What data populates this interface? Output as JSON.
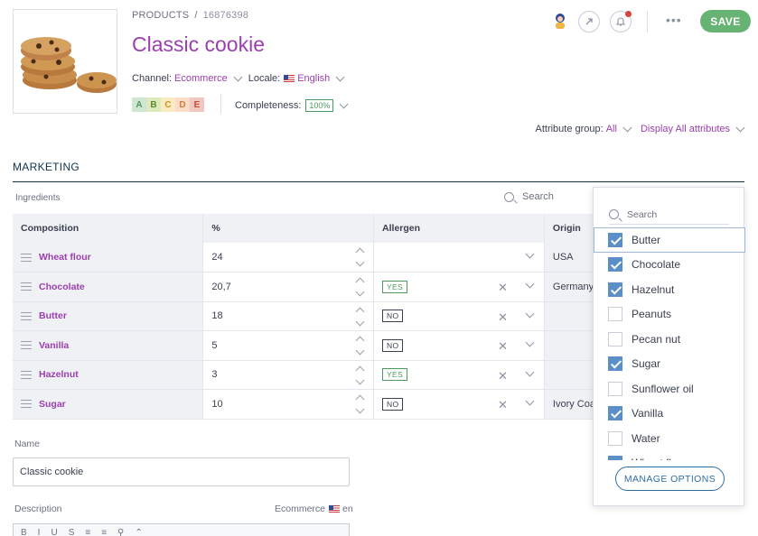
{
  "breadcrumb": {
    "root": "PRODUCTS",
    "separator": "/",
    "id": "16876398"
  },
  "product": {
    "title": "Classic cookie"
  },
  "scope": {
    "channel_label": "Channel:",
    "channel": "Ecommerce",
    "locale_label": "Locale:",
    "locale": "English"
  },
  "quality": {
    "grades": [
      {
        "letter": "A",
        "bg": "#cfe6d2",
        "fg": "#4e9a61"
      },
      {
        "letter": "B",
        "bg": "#dde9bf",
        "fg": "#5d8a2c"
      },
      {
        "letter": "C",
        "bg": "#fcebc2",
        "fg": "#c89a23"
      },
      {
        "letter": "D",
        "bg": "#fbdcc9",
        "fg": "#d27a3a"
      },
      {
        "letter": "E",
        "bg": "#f1c7c0",
        "fg": "#c44b3d"
      }
    ],
    "completeness_label": "Completeness:",
    "completeness_value": "100%"
  },
  "toolbar": {
    "more": "•••",
    "save": "SAVE",
    "icons": [
      "user-avatar-icon",
      "link-icon",
      "bell-icon"
    ]
  },
  "attributes": {
    "group_label": "Attribute group:",
    "group_value": "All",
    "display": "Display All attributes"
  },
  "section": {
    "title": "MARKETING"
  },
  "ingredients": {
    "label": "Ingredients",
    "search_placeholder": "Search",
    "columns": [
      "Composition",
      "%",
      "Allergen",
      "Origin"
    ],
    "rows": [
      {
        "name": "Wheat flour",
        "pct": "24",
        "allergen": "",
        "origin": "USA"
      },
      {
        "name": "Chocolate",
        "pct": "20,7",
        "allergen": "YES",
        "origin": "Germany"
      },
      {
        "name": "Butter",
        "pct": "18",
        "allergen": "NO",
        "origin": ""
      },
      {
        "name": "Vanilla",
        "pct": "5",
        "allergen": "NO",
        "origin": ""
      },
      {
        "name": "Hazelnut",
        "pct": "3",
        "allergen": "YES",
        "origin": ""
      },
      {
        "name": "Sugar",
        "pct": "10",
        "allergen": "NO",
        "origin": "Ivory Coa"
      }
    ]
  },
  "name_field": {
    "label": "Name",
    "value": "Classic cookie"
  },
  "description": {
    "label": "Description",
    "channel": "Ecommerce",
    "locale": "en",
    "toolbar": [
      "B",
      "I",
      "U",
      "S",
      "≡",
      "≡",
      "⚲",
      "⌃"
    ]
  },
  "options_dropdown": {
    "search_placeholder": "Search",
    "items": [
      {
        "label": "Butter",
        "checked": true,
        "focused": true
      },
      {
        "label": "Chocolate",
        "checked": true
      },
      {
        "label": "Hazelnut",
        "checked": true
      },
      {
        "label": "Peanuts",
        "checked": false
      },
      {
        "label": "Pecan nut",
        "checked": false
      },
      {
        "label": "Sugar",
        "checked": true
      },
      {
        "label": "Sunflower oil",
        "checked": false
      },
      {
        "label": "Vanilla",
        "checked": true
      },
      {
        "label": "Water",
        "checked": false
      },
      {
        "label": "Wheat flour",
        "checked": true
      }
    ],
    "manage_button": "MANAGE OPTIONS"
  }
}
